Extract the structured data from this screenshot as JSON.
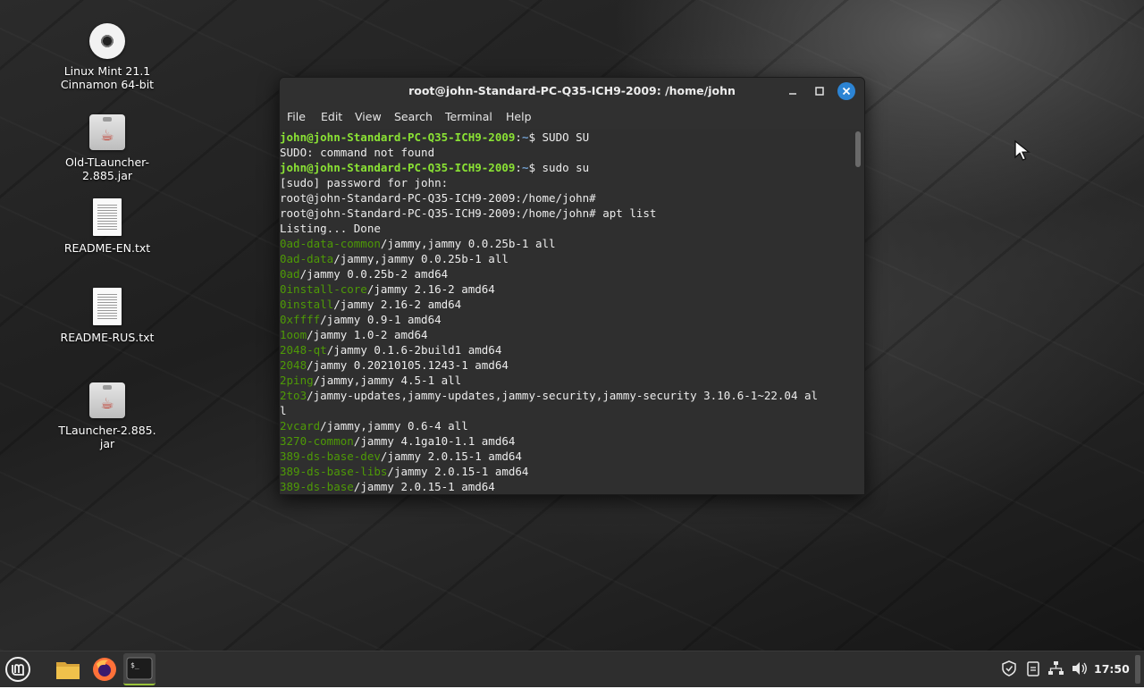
{
  "desktop": {
    "icons": [
      {
        "label": "Linux Mint 21.1\nCinnamon 64-bit",
        "line1": "Linux Mint 21.1",
        "line2": "Cinnamon 64-bit",
        "type": "disc-icon"
      },
      {
        "line1": "Old-TLauncher-",
        "line2": "2.885.jar",
        "type": "jar-icon"
      },
      {
        "line1": "README-EN.txt",
        "line2": "",
        "type": "text-file-icon"
      },
      {
        "line1": "README-RUS.txt",
        "line2": "",
        "type": "text-file-icon"
      },
      {
        "line1": "TLauncher-2.885.",
        "line2": "jar",
        "type": "jar-icon"
      }
    ]
  },
  "terminal": {
    "title": "root@john-Standard-PC-Q35-ICH9-2009: /home/john",
    "window_controls": {
      "minimize": "—",
      "maximize": "□",
      "close": "✕"
    },
    "menu": [
      "File",
      "Edit",
      "View",
      "Search",
      "Terminal",
      "Help"
    ],
    "colors": {
      "user_prompt": "#8ae234",
      "path": "#729fcf",
      "package": "#4e9a06",
      "text": "#ececec",
      "background": "#2f2f2f"
    },
    "lines": [
      {
        "kind": "prompt",
        "user": "john@john-Standard-PC-Q35-ICH9-2009",
        "sep": ":",
        "path": "~",
        "rest": "$ SUDO SU"
      },
      {
        "kind": "text",
        "text": "SUDO: command not found"
      },
      {
        "kind": "prompt",
        "user": "john@john-Standard-PC-Q35-ICH9-2009",
        "sep": ":",
        "path": "~",
        "rest": "$ sudo su"
      },
      {
        "kind": "text",
        "text": "[sudo] password for john:"
      },
      {
        "kind": "text",
        "text": "root@john-Standard-PC-Q35-ICH9-2009:/home/john#"
      },
      {
        "kind": "text",
        "text": "root@john-Standard-PC-Q35-ICH9-2009:/home/john# apt list"
      },
      {
        "kind": "text",
        "text": "Listing... Done"
      },
      {
        "kind": "pkg",
        "name": "0ad-data-common",
        "rest": "/jammy,jammy 0.0.25b-1 all"
      },
      {
        "kind": "pkg",
        "name": "0ad-data",
        "rest": "/jammy,jammy 0.0.25b-1 all"
      },
      {
        "kind": "pkg",
        "name": "0ad",
        "rest": "/jammy 0.0.25b-2 amd64"
      },
      {
        "kind": "pkg",
        "name": "0install-core",
        "rest": "/jammy 2.16-2 amd64"
      },
      {
        "kind": "pkg",
        "name": "0install",
        "rest": "/jammy 2.16-2 amd64"
      },
      {
        "kind": "pkg",
        "name": "0xffff",
        "rest": "/jammy 0.9-1 amd64"
      },
      {
        "kind": "pkg",
        "name": "1oom",
        "rest": "/jammy 1.0-2 amd64"
      },
      {
        "kind": "pkg",
        "name": "2048-qt",
        "rest": "/jammy 0.1.6-2build1 amd64"
      },
      {
        "kind": "pkg",
        "name": "2048",
        "rest": "/jammy 0.20210105.1243-1 amd64"
      },
      {
        "kind": "pkg",
        "name": "2ping",
        "rest": "/jammy,jammy 4.5-1 all"
      },
      {
        "kind": "pkg",
        "name": "2to3",
        "rest": "/jammy-updates,jammy-updates,jammy-security,jammy-security 3.10.6-1~22.04 al"
      },
      {
        "kind": "text",
        "text": "l"
      },
      {
        "kind": "pkg",
        "name": "2vcard",
        "rest": "/jammy,jammy 0.6-4 all"
      },
      {
        "kind": "pkg",
        "name": "3270-common",
        "rest": "/jammy 4.1ga10-1.1 amd64"
      },
      {
        "kind": "pkg",
        "name": "389-ds-base-dev",
        "rest": "/jammy 2.0.15-1 amd64"
      },
      {
        "kind": "pkg",
        "name": "389-ds-base-libs",
        "rest": "/jammy 2.0.15-1 amd64"
      },
      {
        "kind": "pkg",
        "name": "389-ds-base",
        "rest": "/jammy 2.0.15-1 amd64"
      }
    ]
  },
  "taskbar": {
    "buttons": [
      "mint-menu-icon",
      "files-icon",
      "firefox-icon",
      "terminal-icon"
    ],
    "tray": [
      "shield-icon",
      "clipboard-icon",
      "network-icon",
      "volume-icon"
    ],
    "clock": "17:50"
  }
}
